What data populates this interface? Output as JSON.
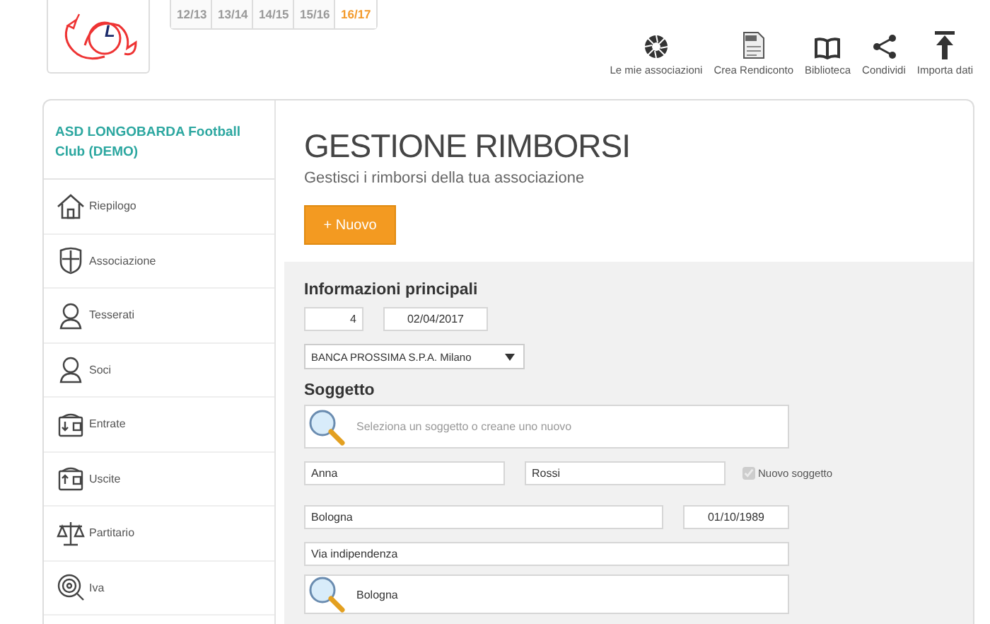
{
  "logo": {
    "letter": "L"
  },
  "seasons": [
    {
      "label": "12/13",
      "selected": false
    },
    {
      "label": "13/14",
      "selected": false
    },
    {
      "label": "14/15",
      "selected": false
    },
    {
      "label": "15/16",
      "selected": false
    },
    {
      "label": "16/17",
      "selected": true
    }
  ],
  "toolbar": [
    {
      "label": "Le mie associazioni",
      "kind": "aperture"
    },
    {
      "label": "Crea Rendiconto",
      "kind": "pdf"
    },
    {
      "label": "Biblioteca",
      "kind": "book"
    },
    {
      "label": "Condividi",
      "kind": "share"
    },
    {
      "label": "Importa dati",
      "kind": "upload"
    }
  ],
  "sidebar": {
    "title": "ASD LONGOBARDA Football Club (DEMO)",
    "items": [
      {
        "label": "Riepilogo",
        "kind": "home"
      },
      {
        "label": "Associazione",
        "kind": "shield"
      },
      {
        "label": "Tesserati",
        "kind": "person"
      },
      {
        "label": "Soci",
        "kind": "person"
      },
      {
        "label": "Entrate",
        "kind": "wallet-in"
      },
      {
        "label": "Uscite",
        "kind": "wallet-out"
      },
      {
        "label": "Partitario",
        "kind": "scale"
      },
      {
        "label": "Iva",
        "kind": "target"
      }
    ]
  },
  "page": {
    "title": "GESTIONE RIMBORSI",
    "subtitle": "Gestisci i rimborsi della tua associazione",
    "new_button": "+ Nuovo"
  },
  "form": {
    "main_heading": "Informazioni principali",
    "number": "4",
    "date": "02/04/2017",
    "bank": "BANCA PROSSIMA S.P.A. Milano",
    "subject_heading": "Soggetto",
    "subject_search": {
      "placeholder": "Seleziona un soggetto o creane uno nuovo"
    },
    "first_name": "Anna",
    "last_name": "Rossi",
    "new_subject": {
      "label": "Nuovo soggetto",
      "checked": true
    },
    "city": "Bologna",
    "birth_date": "01/10/1989",
    "address": "Via indipendenza",
    "place_search": {
      "value": "Bologna"
    }
  }
}
